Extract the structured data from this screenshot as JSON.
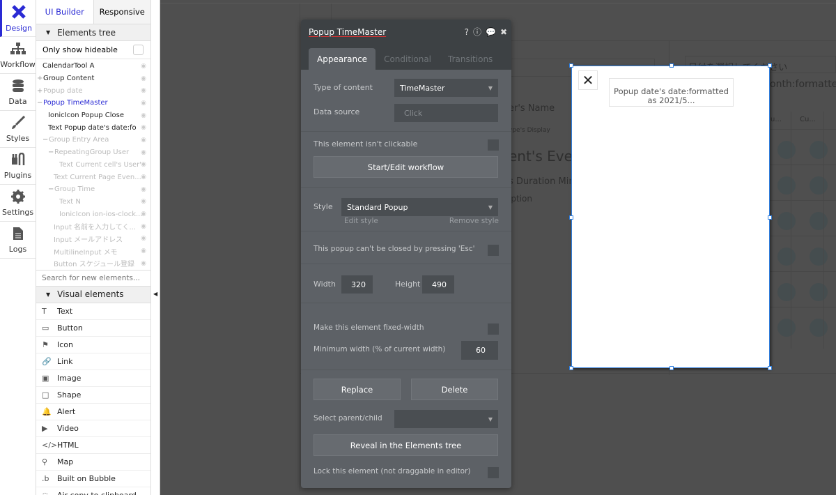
{
  "rail": [
    {
      "label": "Design",
      "icon": "design-icon"
    },
    {
      "label": "Workflow",
      "icon": "workflow-icon"
    },
    {
      "label": "Data",
      "icon": "database-icon"
    },
    {
      "label": "Styles",
      "icon": "brush-icon"
    },
    {
      "label": "Plugins",
      "icon": "plugin-icon"
    },
    {
      "label": "Settings",
      "icon": "gear-icon"
    },
    {
      "label": "Logs",
      "icon": "document-icon"
    }
  ],
  "panel": {
    "tabs": [
      "UI Builder",
      "Responsive"
    ],
    "elements_tree": "Elements tree",
    "only_hideable": "Only show hideable",
    "tree": [
      {
        "label": "CalendarTool A",
        "indent": 0,
        "state": "normal",
        "prefix": ""
      },
      {
        "label": "Group Content",
        "indent": 0,
        "state": "normal",
        "prefix": "+"
      },
      {
        "label": "Popup date",
        "indent": 0,
        "state": "dim",
        "prefix": "+"
      },
      {
        "label": "Popup TimeMaster",
        "indent": 0,
        "state": "sel",
        "prefix": "−"
      },
      {
        "label": "IonicIcon Popup Close",
        "indent": 1,
        "state": "normal",
        "prefix": ""
      },
      {
        "label": "Text Popup date's date:fo",
        "indent": 1,
        "state": "normal",
        "prefix": ""
      },
      {
        "label": "Group Entry Area",
        "indent": 1,
        "state": "dim",
        "prefix": "−"
      },
      {
        "label": "RepeatingGroup User",
        "indent": 2,
        "state": "dim",
        "prefix": "−"
      },
      {
        "label": "Text Current cell's User'",
        "indent": 3,
        "state": "dim",
        "prefix": ""
      },
      {
        "label": "Text Current Page Even...",
        "indent": 2,
        "state": "dim",
        "prefix": ""
      },
      {
        "label": "Group Time",
        "indent": 2,
        "state": "dim",
        "prefix": "−"
      },
      {
        "label": "Text N",
        "indent": 3,
        "state": "dim",
        "prefix": ""
      },
      {
        "label": "IonicIcon ion-ios-clock...",
        "indent": 3,
        "state": "dim",
        "prefix": ""
      },
      {
        "label": "Input 名前を入力してく...",
        "indent": 2,
        "state": "dim",
        "prefix": ""
      },
      {
        "label": "Input メールアドレス",
        "indent": 2,
        "state": "dim",
        "prefix": ""
      },
      {
        "label": "MultilineInput メモ",
        "indent": 2,
        "state": "dim",
        "prefix": ""
      },
      {
        "label": "Button スケジュール登録",
        "indent": 2,
        "state": "dim",
        "prefix": ""
      }
    ],
    "search_placeholder": "Search for new elements...",
    "visual_elements": "Visual elements",
    "visual": [
      {
        "label": "Text",
        "icon": "T"
      },
      {
        "label": "Button",
        "icon": "▭"
      },
      {
        "label": "Icon",
        "icon": "⚑"
      },
      {
        "label": "Link",
        "icon": "🔗"
      },
      {
        "label": "Image",
        "icon": "▣"
      },
      {
        "label": "Shape",
        "icon": "□"
      },
      {
        "label": "Alert",
        "icon": "🔔"
      },
      {
        "label": "Video",
        "icon": "▶"
      },
      {
        "label": "HTML",
        "icon": "</>"
      },
      {
        "label": "Map",
        "icon": "⚲"
      },
      {
        "label": "Built on Bubble",
        "icon": ".b"
      },
      {
        "label": "Air copy to clipboard",
        "icon": "◌"
      }
    ]
  },
  "canvas": {
    "bg_texts": [
      "er's Name",
      "ype's Display",
      "ent's Even",
      "s Duration Min",
      "iption",
      "日付を選択してください",
      "onth:formatte",
      "u...",
      "Cu..."
    ]
  },
  "editor": {
    "title": "Popup TimeMaster",
    "tabs": [
      "Appearance",
      "Conditional",
      "Transitions"
    ],
    "type_label": "Type of content",
    "type_value": "TimeMaster",
    "source_label": "Data source",
    "source_value": "Click",
    "not_clickable": "This element isn't clickable",
    "workflow_btn": "Start/Edit workflow",
    "style_label": "Style",
    "style_value": "Standard Popup",
    "edit_style": "Edit style",
    "remove_style": "Remove style",
    "esc_label": "This popup can't be closed by pressing 'Esc'",
    "width_label": "Width",
    "width_value": "320",
    "height_label": "Height",
    "height_value": "490",
    "fixed_width": "Make this element fixed-width",
    "min_width_label": "Minimum width (% of current width)",
    "min_width_value": "60",
    "replace": "Replace",
    "delete": "Delete",
    "parent_label": "Select parent/child",
    "reveal": "Reveal in the Elements tree",
    "lock": "Lock this element (not draggable in editor)"
  },
  "popup": {
    "text": "Popup date's date:formatted as 2021/5...",
    "close_icon": "close-icon"
  },
  "colors": {
    "accent": "#2a2ad4",
    "selection": "#2f7fe0"
  }
}
